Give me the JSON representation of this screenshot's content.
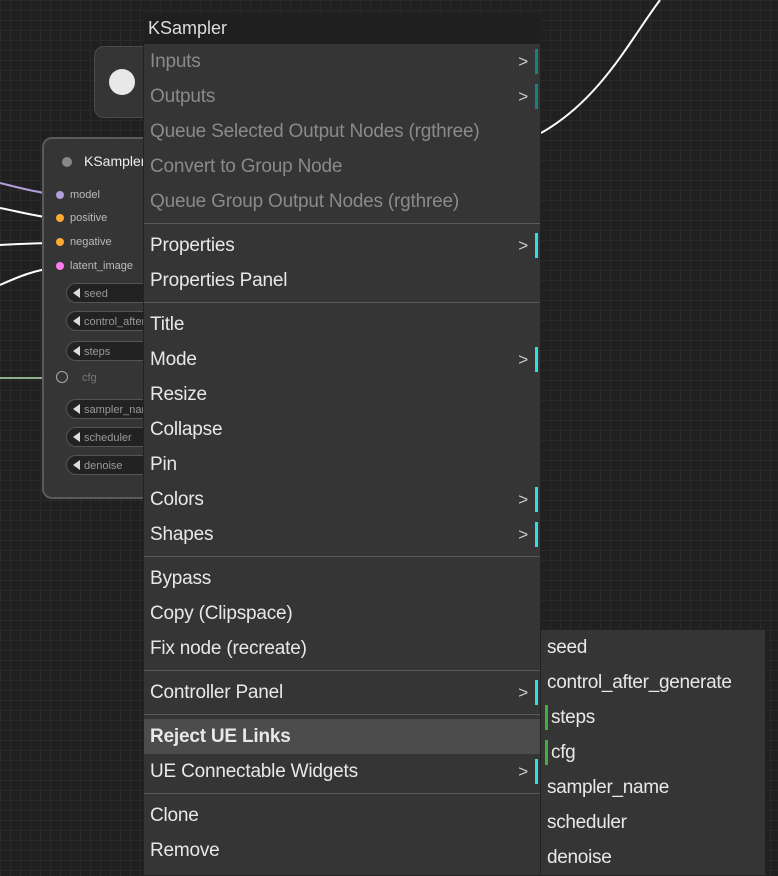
{
  "colors": {
    "accent_bar": "#2ee0e0",
    "widget_marker": "#3fb03f",
    "menu_bg": "#353535",
    "canvas_bg": "#202020"
  },
  "node": {
    "title": "KSampler",
    "inputs": [
      {
        "label": "model",
        "color": "#b39ddb"
      },
      {
        "label": "positive",
        "color": "#ffa931"
      },
      {
        "label": "negative",
        "color": "#ffa931"
      },
      {
        "label": "latent_image",
        "color": "#ff7cf0"
      }
    ],
    "widgets_top": [
      "seed",
      "control_after_generate",
      "steps"
    ],
    "cfg_label": "cfg",
    "widgets_bottom": [
      "sampler_name",
      "scheduler",
      "denoise"
    ]
  },
  "menu": {
    "title": "KSampler",
    "chevron": ">",
    "items": [
      {
        "label": "Inputs",
        "disabled": true,
        "submenu": true
      },
      {
        "label": "Outputs",
        "disabled": true,
        "submenu": true
      },
      {
        "label": "Queue Selected Output Nodes (rgthree)",
        "disabled": true
      },
      {
        "label": "Convert to Group Node",
        "disabled": true
      },
      {
        "label": "Queue Group Output Nodes (rgthree)",
        "disabled": true
      },
      {
        "label": "Properties",
        "submenu": true
      },
      {
        "label": "Properties Panel"
      },
      {
        "label": "Title"
      },
      {
        "label": "Mode",
        "submenu": true
      },
      {
        "label": "Resize"
      },
      {
        "label": "Collapse"
      },
      {
        "label": "Pin"
      },
      {
        "label": "Colors",
        "submenu": true
      },
      {
        "label": "Shapes",
        "submenu": true
      },
      {
        "label": "Bypass"
      },
      {
        "label": "Copy (Clipspace)"
      },
      {
        "label": "Fix node (recreate)"
      },
      {
        "label": "Controller Panel",
        "submenu": true
      },
      {
        "label": "Reject UE Links",
        "highlighted": true
      },
      {
        "label": "UE Connectable Widgets",
        "submenu": true
      },
      {
        "label": "Clone"
      },
      {
        "label": "Remove"
      }
    ]
  },
  "submenu": {
    "items": [
      {
        "label": "seed"
      },
      {
        "label": "control_after_generate"
      },
      {
        "label": "steps",
        "marked": true
      },
      {
        "label": "cfg",
        "marked": true
      },
      {
        "label": "sampler_name"
      },
      {
        "label": "scheduler"
      },
      {
        "label": "denoise"
      }
    ]
  }
}
